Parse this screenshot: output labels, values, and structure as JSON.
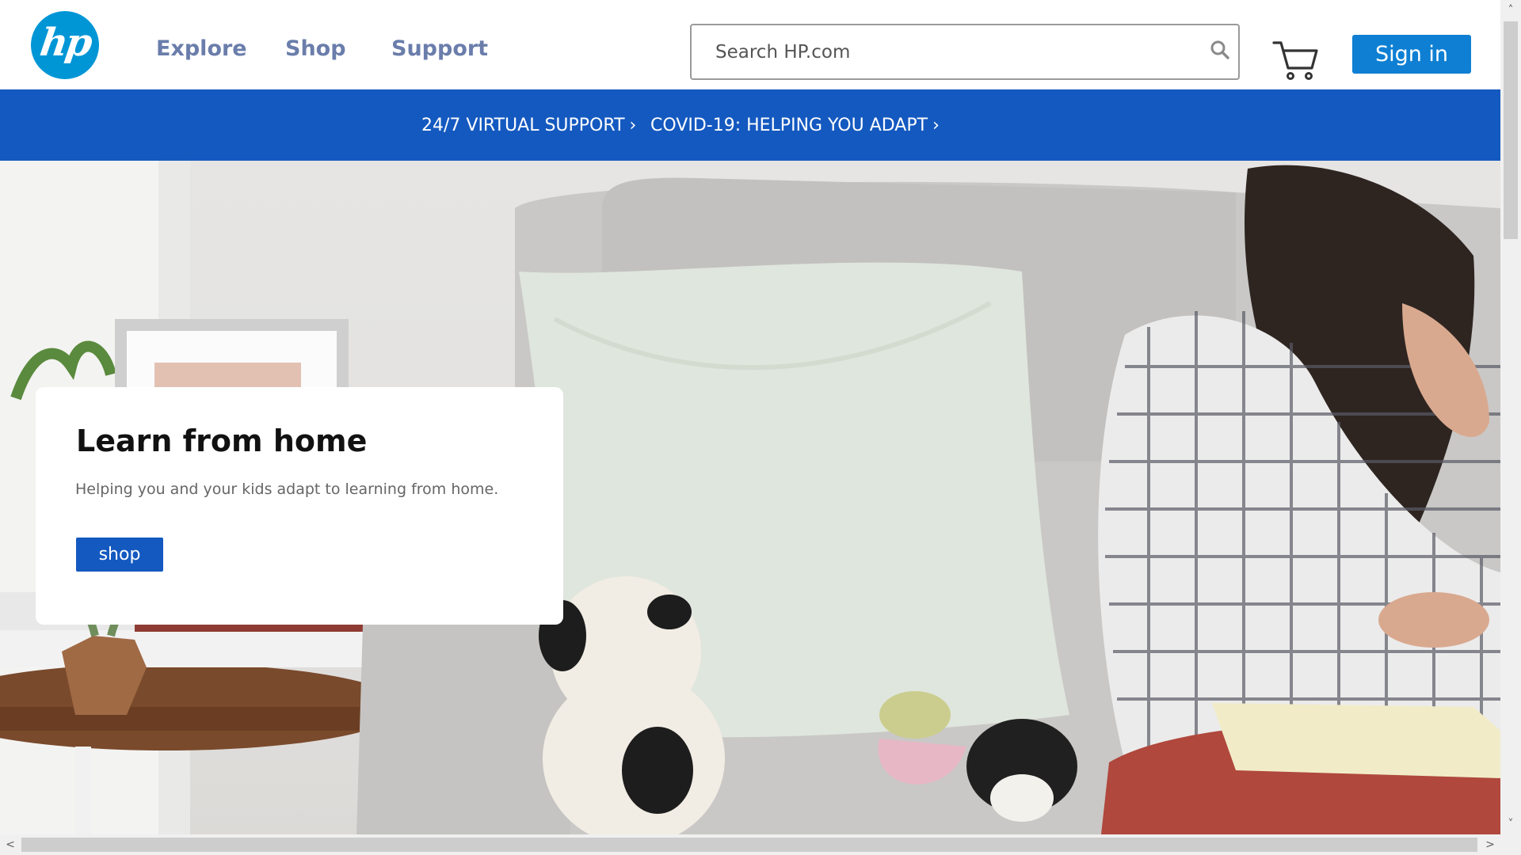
{
  "brand": {
    "logo_text": "hp",
    "logo_color": "#0096d6"
  },
  "nav": {
    "items": [
      {
        "label": "Explore"
      },
      {
        "label": "Shop"
      },
      {
        "label": "Support"
      }
    ],
    "color": "#6a7dab"
  },
  "search": {
    "placeholder": "Search HP.com",
    "value": "",
    "icon": "search-icon"
  },
  "cart": {
    "icon": "cart-icon"
  },
  "account": {
    "sign_in_label": "Sign in",
    "color": "#0e7fd3"
  },
  "promo_bar": {
    "color": "#1459c0",
    "links": [
      {
        "label": "24/7 VIRTUAL SUPPORT",
        "chevron": "›"
      },
      {
        "label": "COVID-19: HELPING YOU ADAPT",
        "chevron": "›"
      }
    ]
  },
  "hero": {
    "title": "Learn from home",
    "subtitle": "Helping you and your kids adapt to learning from home.",
    "cta_label": "shop",
    "cta_color": "#1459c0"
  },
  "scrollbars": {
    "up_arrow": "˄",
    "down_arrow": "˅",
    "left_arrow": "<",
    "right_arrow": ">"
  }
}
